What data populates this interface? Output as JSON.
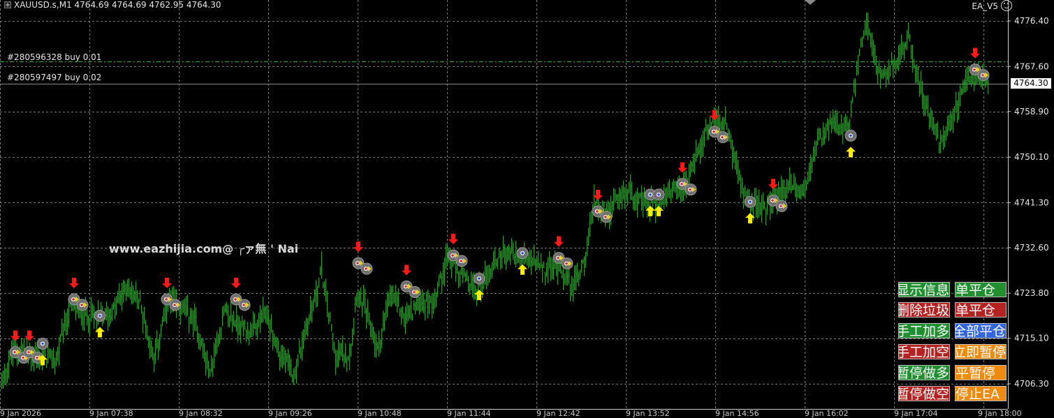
{
  "header": {
    "symbol_line": "XAUUSD.s,M1  4764.69 4764.69 4762.95 4764.30",
    "ea_name": "EA_V5"
  },
  "orders": [
    {
      "label": "#280596328 buy 0.01",
      "price": 4768.6
    },
    {
      "label": "#280597497 buy 0.02",
      "price": 4764.3
    }
  ],
  "watermark": "www.eazhijia.com@ ╭ァ無 ' Nai",
  "current_price": "4764.30",
  "y_axis": {
    "ticks": [
      "4776.40",
      "4767.60",
      "4758.90",
      "4750.10",
      "4741.30",
      "4732.60",
      "4723.80",
      "4715.10",
      "4706.30"
    ],
    "tick_values": [
      4776.4,
      4767.6,
      4758.9,
      4750.1,
      4741.3,
      4732.6,
      4723.8,
      4715.1,
      4706.3
    ]
  },
  "panel": {
    "buttons": [
      {
        "name": "btn-show-info",
        "text": "显示信息",
        "color": "green"
      },
      {
        "name": "btn-close-single-1",
        "text": "单平仓",
        "color": "green"
      },
      {
        "name": "btn-remove-junk",
        "text": "删除垃圾",
        "color": "red"
      },
      {
        "name": "btn-close-single-2",
        "text": "单平仓",
        "color": "red"
      },
      {
        "name": "btn-manual-add-long",
        "text": "手工加多",
        "color": "green"
      },
      {
        "name": "btn-close-all",
        "text": "全部平仓",
        "color": "blue"
      },
      {
        "name": "btn-manual-add-short",
        "text": "手工加空",
        "color": "red"
      },
      {
        "name": "btn-pause-now",
        "text": "立即暂停",
        "color": "orange"
      },
      {
        "name": "btn-stop-long",
        "text": "暂停做多",
        "color": "green"
      },
      {
        "name": "btn-close-pause",
        "text": "平暂停",
        "color": "orange"
      },
      {
        "name": "btn-stop-short",
        "text": "暂停做空",
        "color": "red"
      },
      {
        "name": "btn-stop-ea",
        "text": "停止EA",
        "color": "orange"
      }
    ]
  },
  "time_labels": [
    "9 Jan 2026",
    "9 Jan 07:38",
    "9 Jan 08:32",
    "9 Jan 09:26",
    "9 Jan 10:48",
    "9 Jan 11:44",
    "9 Jan 12:42",
    "9 Jan 13:52",
    "9 Jan 14:56",
    "9 Jan 16:02",
    "9 Jan 17:04",
    "9 Jan 18:00"
  ],
  "chart_data": {
    "type": "bar",
    "symbol": "XAUUSD.s",
    "timeframe": "M1",
    "ylim": [
      4703.0,
      4779.0
    ],
    "grid": true,
    "series_color": "#2e9e2e",
    "anchors": [
      [
        0,
        4706.3
      ],
      [
        20,
        4713
      ],
      [
        40,
        4712
      ],
      [
        60,
        4711
      ],
      [
        80,
        4711
      ],
      [
        100,
        4721
      ],
      [
        120,
        4720
      ],
      [
        140,
        4719
      ],
      [
        160,
        4720
      ],
      [
        180,
        4725
      ],
      [
        200,
        4722
      ],
      [
        220,
        4711
      ],
      [
        240,
        4722
      ],
      [
        260,
        4721
      ],
      [
        280,
        4718
      ],
      [
        300,
        4708
      ],
      [
        320,
        4720
      ],
      [
        340,
        4718
      ],
      [
        360,
        4716
      ],
      [
        380,
        4720
      ],
      [
        400,
        4712
      ],
      [
        420,
        4708
      ],
      [
        440,
        4718
      ],
      [
        460,
        4728
      ],
      [
        480,
        4712
      ],
      [
        500,
        4712
      ],
      [
        510,
        4724
      ],
      [
        520,
        4722
      ],
      [
        540,
        4713
      ],
      [
        560,
        4724
      ],
      [
        580,
        4719
      ],
      [
        600,
        4722
      ],
      [
        620,
        4722
      ],
      [
        640,
        4731
      ],
      [
        660,
        4727
      ],
      [
        680,
        4724
      ],
      [
        700,
        4728
      ],
      [
        720,
        4732
      ],
      [
        740,
        4731
      ],
      [
        760,
        4730
      ],
      [
        780,
        4728
      ],
      [
        800,
        4729
      ],
      [
        820,
        4725
      ],
      [
        840,
        4732
      ],
      [
        850,
        4742
      ],
      [
        870,
        4739
      ],
      [
        880,
        4741
      ],
      [
        900,
        4744
      ],
      [
        920,
        4741
      ],
      [
        940,
        4741
      ],
      [
        960,
        4743
      ],
      [
        980,
        4744
      ],
      [
        1000,
        4752
      ],
      [
        1020,
        4757
      ],
      [
        1040,
        4756
      ],
      [
        1060,
        4745
      ],
      [
        1075,
        4741
      ],
      [
        1090,
        4740
      ],
      [
        1110,
        4742
      ],
      [
        1130,
        4745
      ],
      [
        1150,
        4743
      ],
      [
        1170,
        4753
      ],
      [
        1190,
        4756
      ],
      [
        1215,
        4755
      ],
      [
        1225,
        4766
      ],
      [
        1240,
        4777
      ],
      [
        1260,
        4765
      ],
      [
        1280,
        4768
      ],
      [
        1300,
        4773
      ],
      [
        1320,
        4762
      ],
      [
        1345,
        4753
      ],
      [
        1360,
        4757
      ],
      [
        1380,
        4764
      ],
      [
        1400,
        4766
      ],
      [
        1414,
        4764
      ]
    ],
    "sell_arrows": [
      [
        22,
        4714.3
      ],
      [
        42,
        4714.3
      ],
      [
        106,
        4724.5
      ],
      [
        239,
        4724.5
      ],
      [
        338,
        4724.5
      ],
      [
        513,
        4731.5
      ],
      [
        582,
        4727
      ],
      [
        649,
        4733
      ],
      [
        800,
        4732.5
      ],
      [
        856,
        4741.5
      ],
      [
        977,
        4746.8
      ],
      [
        1023,
        4756.9
      ],
      [
        1107,
        4743.6
      ],
      [
        1396,
        4768.9
      ]
    ],
    "buy_arrows": [
      [
        61,
        4710
      ],
      [
        143,
        4715.4
      ],
      [
        686,
        4722.6
      ],
      [
        748,
        4727.5
      ],
      [
        931,
        4738.8
      ],
      [
        943,
        4738.8
      ],
      [
        1074,
        4737.4
      ],
      [
        1218,
        4750.2
      ]
    ]
  }
}
